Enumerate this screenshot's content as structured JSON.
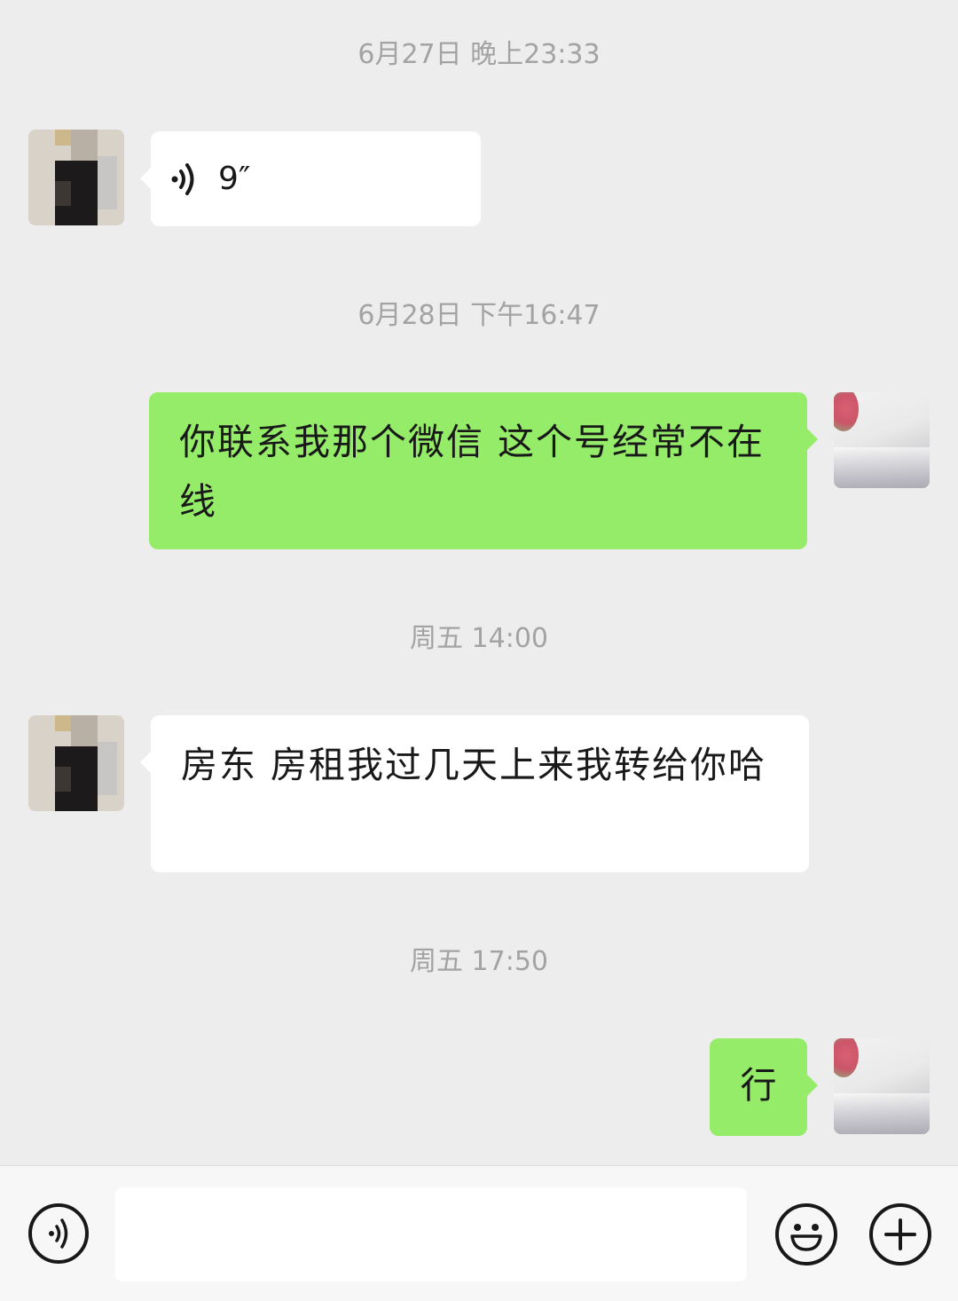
{
  "messages": [
    {
      "type": "timestamp",
      "text": "6月27日 晚上23:33"
    },
    {
      "type": "voice",
      "side": "left",
      "duration": "9″"
    },
    {
      "type": "timestamp",
      "text": "6月28日 下午16:47"
    },
    {
      "type": "text",
      "side": "right",
      "text": "你联系我那个微信 这个号经常不在线"
    },
    {
      "type": "timestamp",
      "text": "周五 14:00"
    },
    {
      "type": "text",
      "side": "left",
      "text": "房东 房租我过几天上来我转给你哈"
    },
    {
      "type": "timestamp",
      "text": "周五 17:50"
    },
    {
      "type": "text",
      "side": "right",
      "text": "行"
    }
  ],
  "input_bar": {
    "voice_icon": "voice-input-icon",
    "text_value": "",
    "emoji_icon": "smiley-icon",
    "plus_icon": "plus-icon"
  },
  "colors": {
    "background": "#ededed",
    "self_bubble": "#95ec69",
    "other_bubble": "#ffffff",
    "timestamp": "#a3a3a3"
  }
}
